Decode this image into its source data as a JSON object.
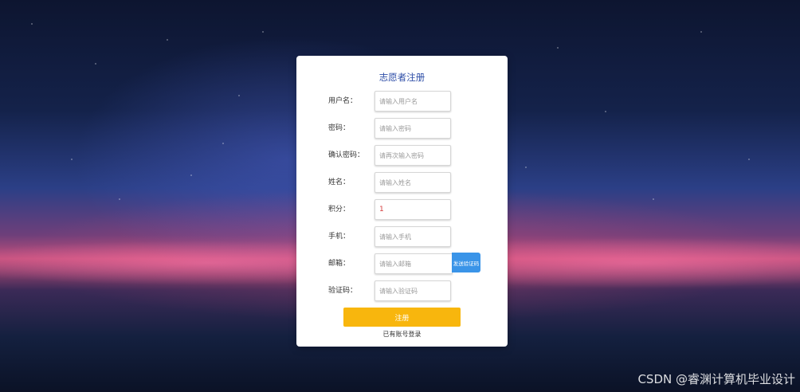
{
  "form": {
    "title": "志愿者注册",
    "fields": [
      {
        "label": "用户名：",
        "placeholder": "请输入用户名",
        "value": ""
      },
      {
        "label": "密码：",
        "placeholder": "请输入密码",
        "value": ""
      },
      {
        "label": "确认密码：",
        "placeholder": "请再次输入密码",
        "value": ""
      },
      {
        "label": "姓名：",
        "placeholder": "请输入姓名",
        "value": ""
      },
      {
        "label": "积分：",
        "placeholder": "",
        "value": "1"
      },
      {
        "label": "手机：",
        "placeholder": "请输入手机",
        "value": ""
      },
      {
        "label": "邮箱：",
        "placeholder": "请输入邮箱",
        "value": ""
      },
      {
        "label": "验证码：",
        "placeholder": "请输入验证码",
        "value": ""
      }
    ],
    "send_code_label": "发送验证码",
    "submit_label": "注册",
    "login_link": "已有账号登录"
  },
  "watermark": "CSDN @睿渊计算机毕业设计",
  "colors": {
    "title": "#2f4fa8",
    "submit_button": "#f8b60d",
    "send_code_button": "#3a94e8",
    "card": "#ffffff"
  }
}
